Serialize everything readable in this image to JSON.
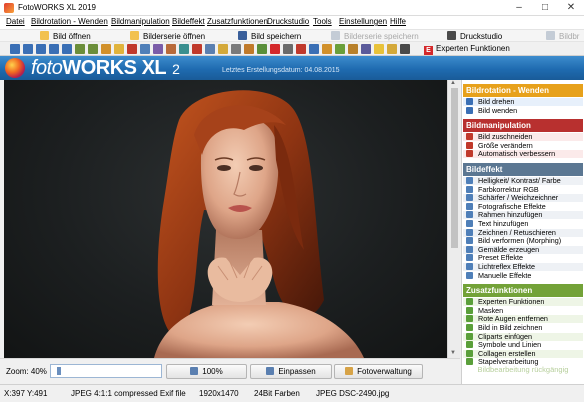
{
  "window": {
    "title": "FotoWORKS XL 2019"
  },
  "menu": [
    "Datei",
    "Bildrotation - Wenden",
    "Bildmanipulation",
    "Bildeffekt",
    "Zusatzfunktionen",
    "Druckstudio",
    "Tools",
    "Einstellungen",
    "Hilfe"
  ],
  "toolbar_main": {
    "open_image": "Bild öffnen",
    "open_series": "Bilderserie öffnen",
    "save_image": "Bild speichern",
    "save_series": "Bilderserie speichern",
    "print_studio": "Druckstudio",
    "image_browser": "Bildbr"
  },
  "toolbar_icons": [
    "rotate-left",
    "rotate-right",
    "rotate-180",
    "flip-h",
    "flip-v",
    "crop",
    "resize",
    "auto-enhance",
    "brightness",
    "color",
    "sharpen",
    "effects",
    "frame",
    "text",
    "draw",
    "morph",
    "paint",
    "preset",
    "lens",
    "manual",
    "expert",
    "mask",
    "red-eye",
    "picture-in-picture",
    "clipart",
    "symbols",
    "collage",
    "batch",
    "star",
    "folder",
    "print"
  ],
  "expert_button": "Experten Funktionen",
  "brand": {
    "name_light": "foto",
    "name_bold": "WORKS",
    "suffix": "XL",
    "version": "2",
    "last_created": "Letztes Erstellungsdatum: 04.08.2015"
  },
  "viewer": {
    "zoom_label": "Zoom: 40%",
    "zoom_value": 0.4,
    "btn_100": "100%",
    "btn_fit": "Einpassen",
    "btn_manage": "Fotoverwaltung"
  },
  "status": {
    "coords": "X:397 Y:491",
    "format": "JPEG 4:1:1 compressed Exif file",
    "dimensions": "1920x1470",
    "colors": "24Bit Farben",
    "file": "JPEG DSC-2490.jpg"
  },
  "panel": {
    "sections": [
      {
        "title": "Bildrotation - Wenden",
        "color": "#e7a11b",
        "items": [
          "Bild drehen",
          "Bild wenden"
        ]
      },
      {
        "title": "Bildmanipulation",
        "color": "#b8302f",
        "items": [
          "Bild zuschneiden",
          "Größe verändern",
          "Automatisch verbessern"
        ]
      },
      {
        "title": "Bildeffekt",
        "color": "#5b7792",
        "items": [
          "Helligkeit/ Kontrast/ Farbe",
          "Farbkorrektur RGB",
          "Schärfer / Weichzeichner",
          "Fotografische Effekte",
          "Rahmen hinzufügen",
          "Text hinzufügen",
          "Zeichnen / Retuschieren",
          "Bild verformen (Morphing)",
          "Gemälde erzeugen",
          "Preset Effekte",
          "Lichtreflex Effekte",
          "Manuelle Effekte"
        ]
      },
      {
        "title": "Zusatzfunktionen",
        "color": "#73a238",
        "items": [
          "Experten Funktionen",
          "Masken",
          "Rote Augen entfernen",
          "Bild in Bild zeichnen",
          "Cliparts einfügen",
          "Symbole und Linien",
          "Collagen erstellen",
          "Stapelverarbeitung"
        ]
      }
    ],
    "footer": "Bildbearbeitung rückgängig"
  }
}
